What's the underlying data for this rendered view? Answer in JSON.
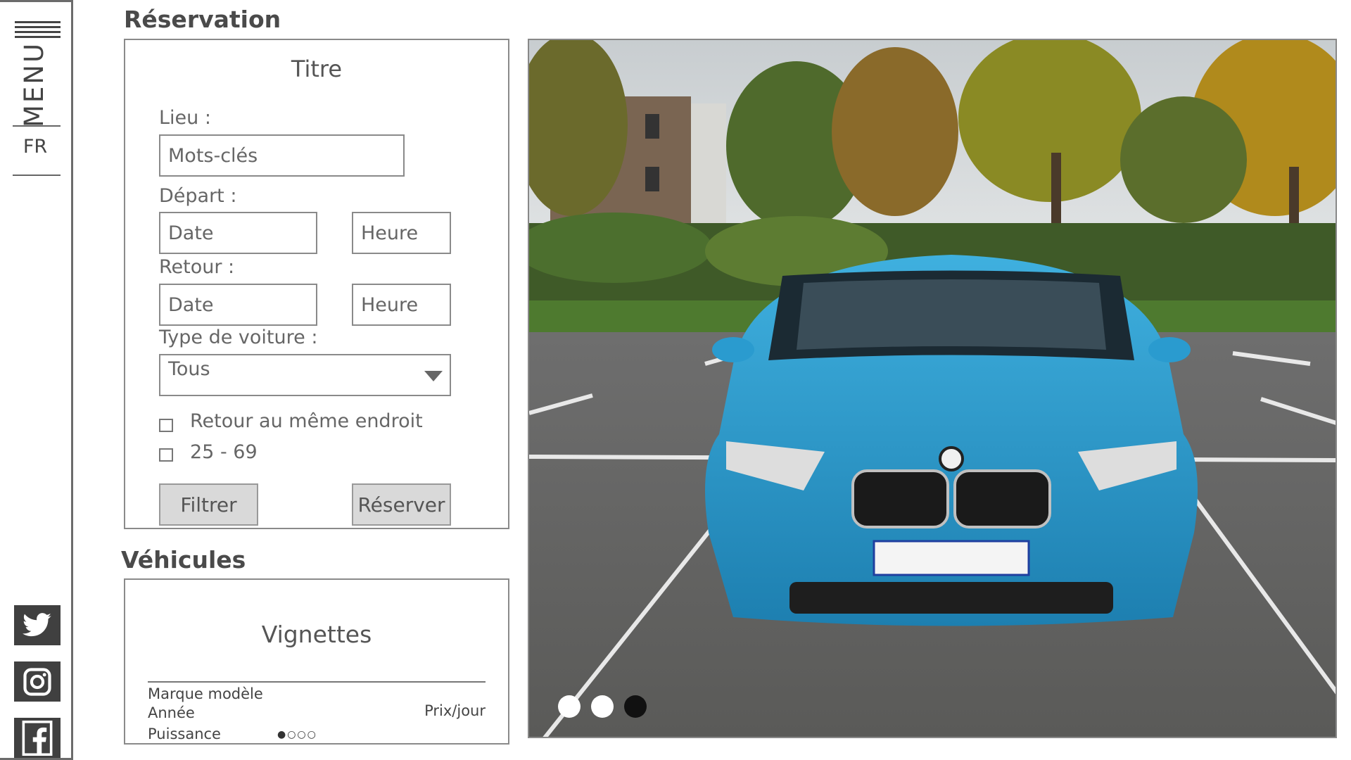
{
  "sidebar": {
    "menu_label": "MENU",
    "language": "FR",
    "social": [
      {
        "name": "twitter",
        "icon": "twitter-icon"
      },
      {
        "name": "instagram",
        "icon": "instagram-icon"
      },
      {
        "name": "facebook",
        "icon": "facebook-icon"
      }
    ]
  },
  "reservation": {
    "heading": "Réservation",
    "title": "Titre",
    "location_label": "Lieu :",
    "location_placeholder": "Mots-clés",
    "departure_label": "Départ :",
    "return_label": "Retour :",
    "date_placeholder": "Date",
    "time_placeholder": "Heure",
    "car_type_label": "Type de voiture  :",
    "car_type_value": "Tous",
    "same_place_label": "Retour au même endroit",
    "age_label": "25 - 69",
    "filter_button": "Filtrer",
    "book_button": "Réserver"
  },
  "vehicles": {
    "heading": "Véhicules",
    "card_title": "Vignettes",
    "brand_model": "Marque modèle",
    "year": "Année",
    "power": "Puissance",
    "price": "Prix/jour",
    "pagination": "●○○○"
  },
  "colors": {
    "car_body": "#2a9bcf",
    "button_bg": "#d9d9d9",
    "border": "#8a8a8a"
  }
}
